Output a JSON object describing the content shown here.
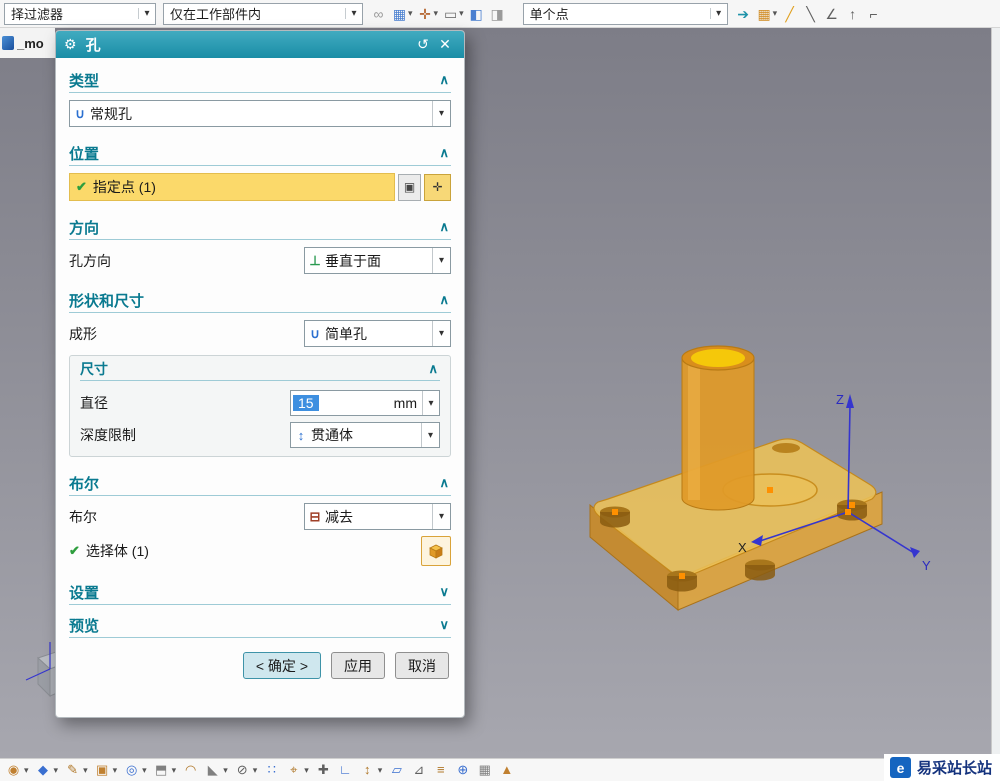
{
  "glyphs": {
    "caret": "▾",
    "chevron_up": "∧",
    "chevron_down": "∨",
    "check": "✔",
    "gear": "⚙",
    "reset": "↺",
    "close": "✕",
    "hole_type": "∪",
    "perpendicular": "⊥",
    "through": "↕",
    "subtract": "⊟",
    "point_dialog": "▣",
    "point_constructor": "✛"
  },
  "colors": {
    "accent_teal": "#1e93a9",
    "section_title": "#0a7a90",
    "highlight_yellow": "#fbd96a",
    "selection_blue": "#3d8fe0",
    "model_orange": "#e8a33d"
  },
  "top_toolbar": {
    "filter_combo": {
      "value": "择过滤器"
    },
    "scope_combo": {
      "value": "仅在工作部件内"
    },
    "point_combo": {
      "value": "单个点"
    },
    "left_icons": [
      {
        "name": "link-icon",
        "glyph": "∞",
        "color": "#9a9a9a"
      },
      {
        "name": "snap-point-icon",
        "glyph": "▦",
        "color": "#4a7fd0",
        "caret": true
      },
      {
        "name": "point-on-curve-icon",
        "glyph": "✛",
        "color": "#b05a20",
        "caret": true
      },
      {
        "name": "selection-rectangle-icon",
        "glyph": "▭",
        "color": "#707070",
        "caret": true
      },
      {
        "name": "solid-body-icon",
        "glyph": "◧",
        "color": "#4a7fd0"
      },
      {
        "name": "facet-body-icon",
        "glyph": "◨",
        "color": "#9a9a9a"
      }
    ],
    "right_icons": [
      {
        "name": "next-selection-icon",
        "glyph": "➔",
        "color": "#1e93a9"
      },
      {
        "name": "snap-grid-icon",
        "glyph": "▦",
        "color": "#d08a20",
        "caret": true
      },
      {
        "name": "sketch-line-icon",
        "glyph": "╱",
        "color": "#e0a020"
      },
      {
        "name": "sketch-slash-icon",
        "glyph": "╲",
        "color": "#606060"
      },
      {
        "name": "angle-snap-icon",
        "glyph": "∠",
        "color": "#606060"
      },
      {
        "name": "vertical-snap-icon",
        "glyph": "↑",
        "color": "#606060"
      },
      {
        "name": "profile-snap-icon",
        "glyph": "⌐",
        "color": "#606060"
      }
    ]
  },
  "tab_bar": {
    "part_label": "_mo"
  },
  "dialog": {
    "title": "孔",
    "type_section": {
      "title": "类型",
      "dropdown_value": "常规孔"
    },
    "position_section": {
      "title": "位置",
      "point_row": "指定点 (1)"
    },
    "direction_section": {
      "title": "方向",
      "row_label": "孔方向",
      "dropdown_value": "垂直于面"
    },
    "shape_section": {
      "title": "形状和尺寸",
      "form_label": "成形",
      "form_value": "简单孔",
      "size_group": {
        "title": "尺寸",
        "diameter_label": "直径",
        "diameter_value": "15",
        "diameter_unit": "mm",
        "depth_label": "深度限制",
        "depth_value": "贯通体"
      }
    },
    "boolean_section": {
      "title": "布尔",
      "row_label": "布尔",
      "dropdown_value": "减去",
      "select_body_label": "选择体 (1)"
    },
    "settings_section": {
      "title": "设置"
    },
    "preview_section": {
      "title": "预览"
    },
    "buttons": {
      "ok": "< 确定 >",
      "apply": "应用",
      "cancel": "取消"
    }
  },
  "viewport": {
    "axis_labels": {
      "x": "X",
      "y": "Y",
      "z": "Z"
    }
  },
  "bottom_toolbar": {
    "icons": [
      {
        "name": "view-orient-icon",
        "glyph": "◉",
        "color": "#c08030",
        "caret": true
      },
      {
        "name": "datum-plane-icon",
        "glyph": "◆",
        "color": "#3a6fd0",
        "caret": true
      },
      {
        "name": "sketch-icon",
        "glyph": "✎",
        "color": "#b0782a",
        "caret": true
      },
      {
        "name": "extrude-icon",
        "glyph": "▣",
        "color": "#c08030",
        "caret": true
      },
      {
        "name": "hole-icon",
        "glyph": "◎",
        "color": "#3a6fd0",
        "caret": true
      },
      {
        "name": "unite-icon",
        "glyph": "⬒",
        "color": "#808080",
        "caret": true
      },
      {
        "name": "edge-blend-icon",
        "glyph": "◠",
        "color": "#b0782a"
      },
      {
        "name": "chamfer-icon",
        "glyph": "◣",
        "color": "#808080",
        "caret": true
      },
      {
        "name": "trim-body-icon",
        "glyph": "⊘",
        "color": "#606060",
        "caret": true
      },
      {
        "name": "pattern-feature-icon",
        "glyph": "∷",
        "color": "#3a6fd0"
      },
      {
        "name": "measure-icon",
        "glyph": "⌖",
        "color": "#b0782a",
        "caret": true
      },
      {
        "name": "move-object-icon",
        "glyph": "✚",
        "color": "#606060"
      },
      {
        "name": "datum-csys-icon",
        "glyph": "∟",
        "color": "#3a6fd0"
      },
      {
        "name": "axis-icon",
        "glyph": "↕",
        "color": "#b0782a",
        "caret": true
      },
      {
        "name": "plane-icon",
        "glyph": "▱",
        "color": "#3a6fd0"
      },
      {
        "name": "angle-measure-icon",
        "glyph": "⊿",
        "color": "#606060"
      },
      {
        "name": "layers-icon",
        "glyph": "≡",
        "color": "#b0782a"
      },
      {
        "name": "info-icon",
        "glyph": "⊕",
        "color": "#3a6fd0"
      },
      {
        "name": "grid-display-icon",
        "glyph": "▦",
        "color": "#808080"
      },
      {
        "name": "annotation-icon",
        "glyph": "▲",
        "color": "#c08030"
      }
    ]
  },
  "watermark": {
    "logo_letter": "e",
    "text": "易采站长站"
  }
}
